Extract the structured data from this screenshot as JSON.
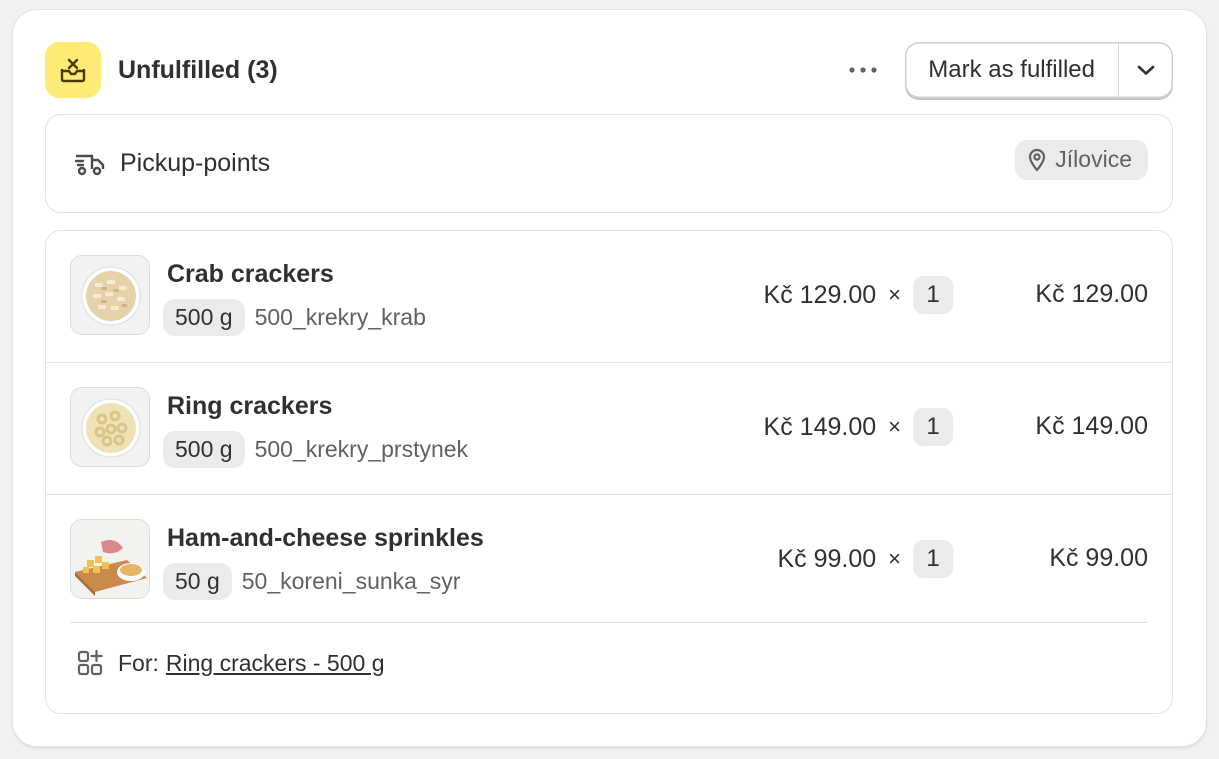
{
  "header": {
    "title": "Unfulfilled (3)",
    "status_icon": "unfulfilled-box-icon",
    "status_color": "#ffeb78",
    "more_icon": "more-horizontal-icon",
    "primary_button": "Mark as fulfilled",
    "dropdown_icon": "chevron-down-icon"
  },
  "delivery": {
    "icon": "truck-icon",
    "method": "Pickup-points",
    "location_icon": "location-pin-icon",
    "location": "Jílovice"
  },
  "items": [
    {
      "name": "Crab crackers",
      "variant": "500 g",
      "sku": "500_krekry_krab",
      "unit_price": "Kč 129.00",
      "times": "×",
      "quantity": "1",
      "total": "Kč 129.00"
    },
    {
      "name": "Ring crackers",
      "variant": "500 g",
      "sku": "500_krekry_prstynek",
      "unit_price": "Kč 149.00",
      "times": "×",
      "quantity": "1",
      "total": "Kč 149.00"
    },
    {
      "name": "Ham-and-cheese sprinkles",
      "variant": "50 g",
      "sku": "50_koreni_sunka_syr",
      "unit_price": "Kč 99.00",
      "times": "×",
      "quantity": "1",
      "total": "Kč 99.00"
    }
  ],
  "bundle_note": {
    "icon": "bundle-icon",
    "prefix": "For:",
    "link": "Ring crackers - 500 g"
  }
}
